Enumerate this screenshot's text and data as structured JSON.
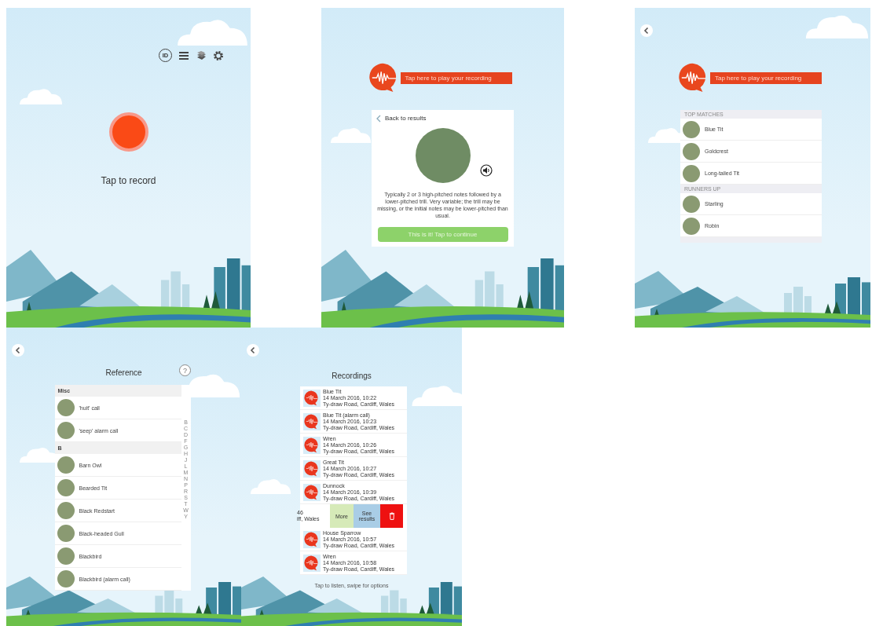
{
  "screens": [
    {
      "kind": "record",
      "id_badge": "ID",
      "record_label": "Tap to record"
    },
    {
      "kind": "detail",
      "play_banner": "Tap here to play your recording",
      "back_link": "Back to results",
      "description": "Typically 2 or 3 high-pitched notes followed by a lower-pitched trill. Very variable; the trill may be missing, or the initial notes may be lower-pitched than usual.",
      "confirm_button": "This is it! Tap to continue"
    },
    {
      "kind": "matches",
      "play_banner": "Tap here to play your recording",
      "sections": [
        {
          "header": "TOP MATCHES",
          "items": [
            "Blue Tit",
            "Goldcrest",
            "Long-tailed Tit"
          ]
        },
        {
          "header": "RUNNERS UP",
          "items": [
            "Starling",
            "Robin"
          ]
        }
      ]
    },
    {
      "kind": "reference",
      "title": "Reference",
      "help": "?",
      "sections": [
        {
          "header": "Misc",
          "items": [
            "'huit' call",
            "'seep' alarm call"
          ]
        },
        {
          "header": "B",
          "items": [
            "Barn Owl",
            "Bearded Tit",
            "Black Redstart",
            "Black-headed Gull",
            "Blackbird",
            "Blackbird (alarm call)"
          ]
        }
      ],
      "index": [
        "B",
        "C",
        "D",
        "F",
        "G",
        "H",
        "J",
        "L",
        "M",
        "N",
        "P",
        "R",
        "S",
        "T",
        "W",
        "Y"
      ]
    },
    {
      "kind": "recordings",
      "title": "Recordings",
      "recordings": [
        {
          "kind": "recording",
          "name": "Blue Tit",
          "date": "14 March 2016, 10:22",
          "place": "Ty-draw Road, Cardiff, Wales"
        },
        {
          "kind": "recording",
          "name": "Blue Tit (alarm call)",
          "date": "14 March 2016, 10:23",
          "place": "Ty-draw Road, Cardiff, Wales"
        },
        {
          "kind": "recording",
          "name": "Wren",
          "date": "14 March 2016, 10:26",
          "place": "Ty-draw Road, Cardiff, Wales"
        },
        {
          "kind": "recording",
          "name": "Great Tit",
          "date": "14 March 2016, 10:27",
          "place": "Ty-draw Road, Cardiff, Wales"
        },
        {
          "kind": "recording",
          "name": "Dunnock",
          "date": "14 March 2016, 10:39",
          "place": "Ty-draw Road, Cardiff, Wales"
        },
        {
          "kind": "swiped",
          "date": "46",
          "place": "iff, Wales",
          "actions": [
            {
              "kind": "more",
              "label": "More"
            },
            {
              "kind": "results",
              "label": "See results"
            },
            {
              "kind": "delete"
            }
          ]
        },
        {
          "kind": "recording",
          "name": "House Sparrow",
          "date": "14 March 2016, 10:57",
          "place": "Ty-draw Road, Cardiff, Wales"
        },
        {
          "kind": "recording",
          "name": "Wren",
          "date": "14 March 2016, 10:58",
          "place": "Ty-draw Road, Cardiff, Wales"
        }
      ],
      "footer": "Tap to listen, swipe for options"
    }
  ]
}
